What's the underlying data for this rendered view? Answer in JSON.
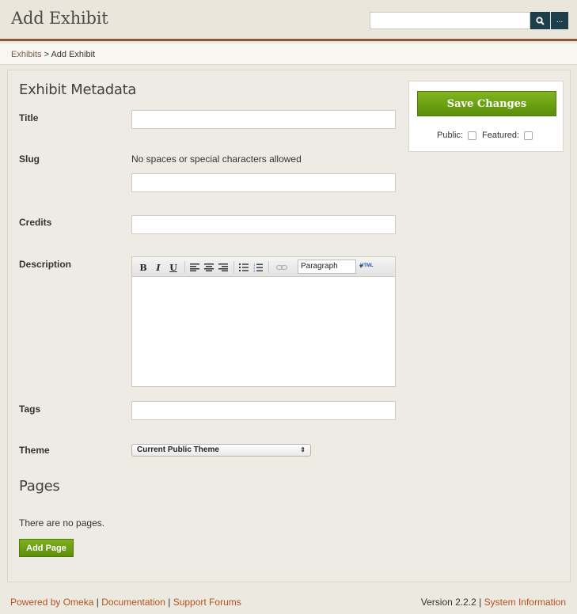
{
  "header": {
    "title": "Add Exhibit",
    "search": {
      "value": "",
      "placeholder": "",
      "more_label": "..."
    }
  },
  "breadcrumb": {
    "parent": "Exhibits",
    "separator": " > ",
    "current": "Add Exhibit"
  },
  "form": {
    "section_title": "Exhibit Metadata",
    "title_label": "Title",
    "title_value": "",
    "slug_label": "Slug",
    "slug_hint": "No spaces or special characters allowed",
    "slug_value": "",
    "credits_label": "Credits",
    "credits_value": "",
    "description_label": "Description",
    "editor": {
      "bold": "B",
      "italic": "I",
      "underline": "U",
      "format_selected": "Paragraph",
      "html_label": "HTML",
      "content": ""
    },
    "tags_label": "Tags",
    "tags_value": "",
    "theme_label": "Theme",
    "theme_selected": "Current Public Theme"
  },
  "pages": {
    "title": "Pages",
    "empty_text": "There are no pages.",
    "add_button": "Add Page"
  },
  "sidebar": {
    "save_button": "Save Changes",
    "public_label": "Public:",
    "public_checked": false,
    "featured_label": "Featured:",
    "featured_checked": false
  },
  "footer": {
    "powered": "Powered by Omeka",
    "documentation": "Documentation",
    "support": "Support Forums",
    "separator": " | ",
    "version": "Version 2.2.2",
    "system_info": "System Information"
  },
  "colors": {
    "accent_green": "#6a9e14",
    "header_rule": "#8d5638",
    "search_button": "#1f3e4c",
    "link": "#b5521e"
  }
}
